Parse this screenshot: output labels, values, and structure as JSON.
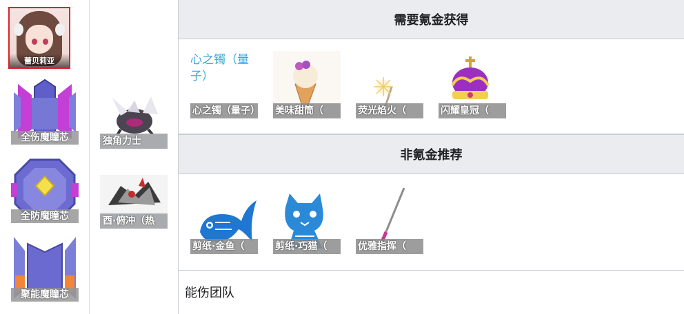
{
  "character": {
    "name": "蕾贝莉亚"
  },
  "cores": [
    {
      "label": "全伤魔瞳芯",
      "icon": "all-damage-core-icon"
    },
    {
      "label": "全防魔瞳芯",
      "icon": "all-defense-core-icon"
    },
    {
      "label": "聚能魔瞳芯",
      "icon": "energy-core-icon"
    }
  ],
  "allies": [
    {
      "label": "独角力士",
      "icon": "unicorn-beetle-icon"
    },
    {
      "label": "酉·俯冲（热",
      "icon": "rooster-dive-icon"
    }
  ],
  "sections": {
    "paid": {
      "heading": "需要氪金获得",
      "link_text": "心之镯（量子）",
      "items": [
        {
          "label": "心之镯（量子）",
          "icon": "heart-bracelet-icon"
        },
        {
          "label": "美味甜筒（",
          "icon": "ice-cream-icon"
        },
        {
          "label": "荧光焰火（",
          "icon": "sparkler-icon"
        },
        {
          "label": "闪耀皇冠（",
          "icon": "crown-icon"
        }
      ]
    },
    "free": {
      "heading": "非氪金推荐",
      "items": [
        {
          "label": "剪纸·金鱼（",
          "icon": "papercut-goldfish-icon"
        },
        {
          "label": "剪纸·巧猫（",
          "icon": "papercut-cat-icon"
        },
        {
          "label": "优雅指挥（",
          "icon": "baton-icon"
        }
      ]
    }
  },
  "footer_text": "能伤团队",
  "colors": {
    "link": "#36a8d6",
    "header_bg": "#eaecf0",
    "portrait_border": "#d8232a"
  }
}
